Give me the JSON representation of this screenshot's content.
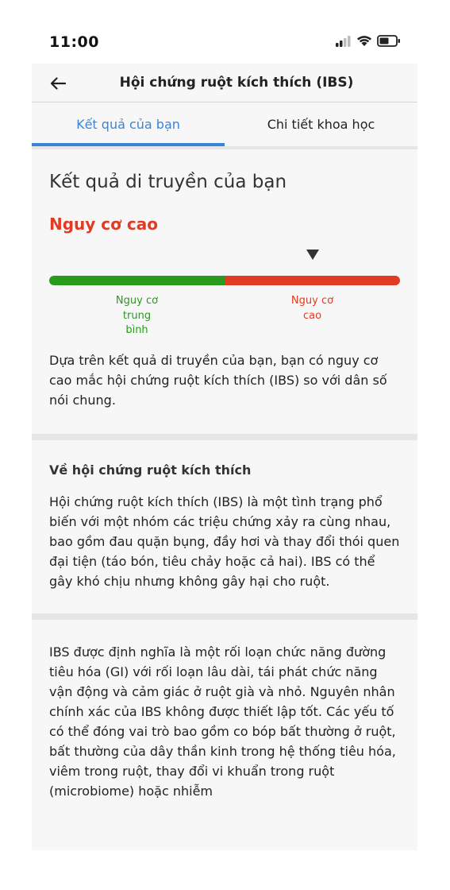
{
  "status_bar": {
    "time": "11:00"
  },
  "header": {
    "title": "Hội chứng ruột kích thích (IBS)"
  },
  "tabs": [
    {
      "label": "Kết quả của bạn",
      "active": true
    },
    {
      "label": "Chi tiết khoa học",
      "active": false
    }
  ],
  "result": {
    "heading": "Kết quả di truyền của bạn",
    "risk_level": "Nguy cơ cao",
    "risk_color": "#e23b23",
    "scale": {
      "segments": [
        {
          "label": "Nguy cơ trung bình",
          "color": "#2a9a1c"
        },
        {
          "label": "Nguy cơ cao",
          "color": "#e23b23"
        }
      ],
      "marker_on_segment": "Nguy cơ cao"
    },
    "description": "Dựa trên kết quả di truyền của bạn, bạn có nguy cơ cao mắc hội chứng ruột kích thích (IBS) so với dân số nói chung."
  },
  "about": {
    "title": "Về hội chứng ruột kích thích",
    "text": "Hội chứng ruột kích thích (IBS) là một tình trạng phổ biến với một nhóm các triệu chứng xảy ra cùng nhau, bao gồm đau quặn bụng, đầy hơi và thay đổi thói quen đại tiện (táo bón, tiêu chảy hoặc cả hai). IBS có thể gây khó chịu nhưng không gây hại cho ruột."
  },
  "more": {
    "text": "IBS được định nghĩa là một rối loạn chức năng đường tiêu hóa (GI) với rối loạn lâu dài, tái phát chức năng vận động và cảm giác ở ruột già và nhỏ. Nguyên nhân chính xác của IBS không được thiết lập tốt. Các yếu tố có thể đóng vai trò bao gồm co bóp bất thường ở ruột, bất thường của dây thần kinh trong hệ thống tiêu hóa, viêm trong ruột, thay đổi vi khuẩn trong ruột (microbiome) hoặc nhiễm"
  },
  "colors": {
    "accent": "#3a85d6",
    "green": "#2a9a1c",
    "red": "#e23b23"
  }
}
